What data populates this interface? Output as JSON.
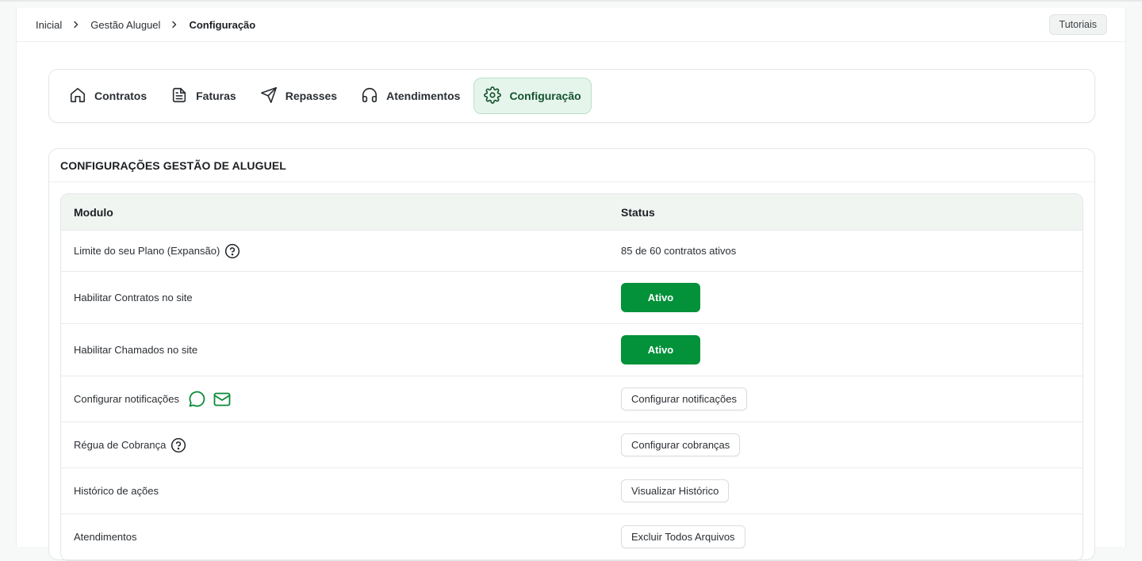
{
  "breadcrumb": {
    "items": [
      "Inicial",
      "Gestão Aluguel",
      "Configuração"
    ]
  },
  "header": {
    "tutorials_label": "Tutoriais"
  },
  "tabs": [
    {
      "label": "Contratos",
      "icon": "home-icon",
      "active": false
    },
    {
      "label": "Faturas",
      "icon": "document-icon",
      "active": false
    },
    {
      "label": "Repasses",
      "icon": "send-icon",
      "active": false
    },
    {
      "label": "Atendimentos",
      "icon": "headphones-icon",
      "active": false
    },
    {
      "label": "Configuração",
      "icon": "gear-icon",
      "active": true
    }
  ],
  "config": {
    "title": "CONFIGURAÇÕES GESTÃO DE ALUGUEL",
    "columns": {
      "module": "Modulo",
      "status": "Status"
    },
    "rows": [
      {
        "module": "Limite do seu Plano (Expansão)",
        "status_text": "85 de 60 contratos ativos"
      },
      {
        "module": "Habilitar Contratos no site",
        "button": "Ativo"
      },
      {
        "module": "Habilitar Chamados no site",
        "button": "Ativo"
      },
      {
        "module": "Configurar notificações",
        "button": "Configurar notificações"
      },
      {
        "module": "Régua de Cobrança",
        "button": "Configurar cobranças"
      },
      {
        "module": "Histórico de ações",
        "button": "Visualizar Histórico"
      },
      {
        "module": "Atendimentos",
        "button": "Excluir Todos Arquivos"
      }
    ]
  },
  "colors": {
    "accent": "#03913a",
    "active_tab_bg": "#e6f5ec",
    "table_header_bg": "#f0f5f2"
  }
}
